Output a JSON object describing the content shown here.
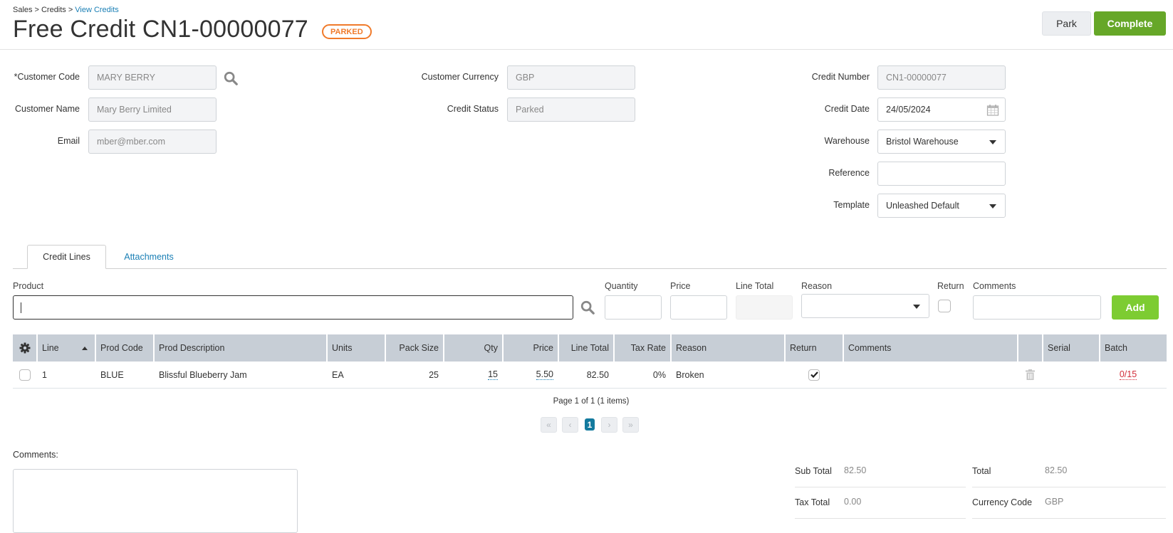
{
  "breadcrumb": {
    "items": [
      "Sales",
      "Credits",
      "View Credits"
    ],
    "separator": ">"
  },
  "header": {
    "title": "Free Credit CN1-00000077",
    "status_badge": "PARKED",
    "park_label": "Park",
    "complete_label": "Complete"
  },
  "form": {
    "customer_code": {
      "label": "*Customer Code",
      "value": "MARY BERRY"
    },
    "customer_name": {
      "label": "Customer Name",
      "value": "Mary Berry Limited"
    },
    "email": {
      "label": "Email",
      "value": "mber@mber.com"
    },
    "customer_currency": {
      "label": "Customer Currency",
      "value": "GBP"
    },
    "credit_status": {
      "label": "Credit Status",
      "value": "Parked"
    },
    "credit_number": {
      "label": "Credit Number",
      "value": "CN1-00000077"
    },
    "credit_date": {
      "label": "Credit Date",
      "value": "24/05/2024"
    },
    "warehouse": {
      "label": "Warehouse",
      "value": "Bristol Warehouse"
    },
    "reference": {
      "label": "Reference",
      "value": ""
    },
    "template": {
      "label": "Template",
      "value": "Unleashed Default"
    }
  },
  "tabs": [
    {
      "label": "Credit Lines",
      "active": true
    },
    {
      "label": "Attachments",
      "active": false
    }
  ],
  "add_line": {
    "product_label": "Product",
    "product_value": "",
    "quantity_label": "Quantity",
    "price_label": "Price",
    "line_total_label": "Line Total",
    "reason_label": "Reason",
    "reason_value": "",
    "return_label": "Return",
    "return_checked": false,
    "comments_label": "Comments",
    "add_label": "Add"
  },
  "grid": {
    "columns": [
      "Line",
      "Prod Code",
      "Prod Description",
      "Units",
      "Pack Size",
      "Qty",
      "Price",
      "Line Total",
      "Tax Rate",
      "Reason",
      "Return",
      "Comments",
      "",
      "Serial",
      "Batch"
    ],
    "rows": [
      {
        "line": "1",
        "prod_code": "BLUE",
        "prod_description": "Blissful Blueberry Jam",
        "units": "EA",
        "pack_size": "25",
        "qty": "15",
        "price": "5.50",
        "line_total": "82.50",
        "tax_rate": "0%",
        "reason": "Broken",
        "return": true,
        "comments": "",
        "serial": "",
        "batch": "0/15"
      }
    ]
  },
  "pager": {
    "summary": "Page 1 of 1 (1 items)",
    "current_page": "1",
    "first": "«",
    "prev": "‹",
    "next": "›",
    "last": "»"
  },
  "footer": {
    "comments_label": "Comments:",
    "comments_value": "",
    "sub_total_label": "Sub Total",
    "sub_total": "82.50",
    "tax_total_label": "Tax Total",
    "tax_total": "0.00",
    "total_label": "Total",
    "total": "82.50",
    "currency_code_label": "Currency Code",
    "currency_code": "GBP"
  },
  "colors": {
    "accent_link": "#1a7fb5",
    "complete_button": "#66a728",
    "add_button": "#7dcc32",
    "parked_badge": "#f07a2a",
    "batch_warning": "#d22d3a",
    "pager_current": "#137a9e"
  }
}
